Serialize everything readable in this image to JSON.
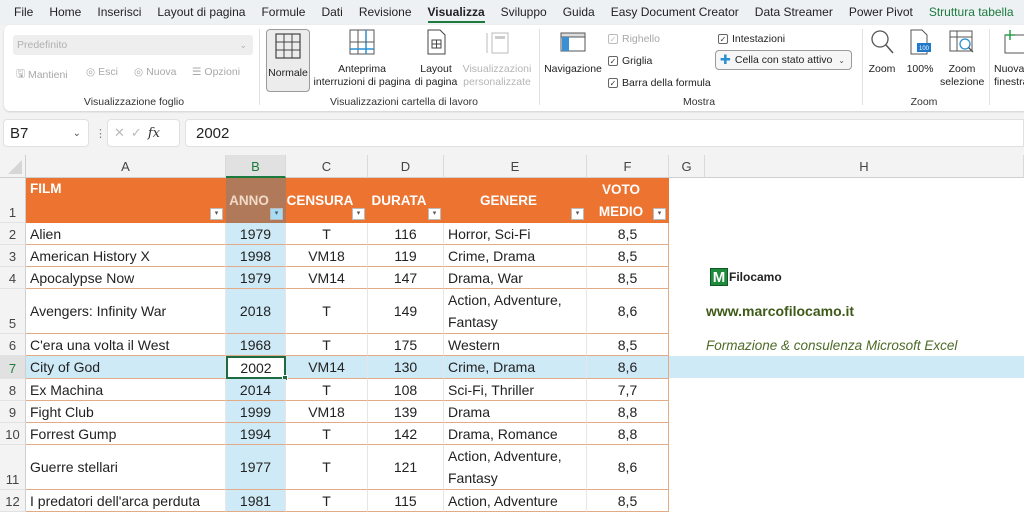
{
  "tabs": [
    {
      "label": "File"
    },
    {
      "label": "Home"
    },
    {
      "label": "Inserisci"
    },
    {
      "label": "Layout di pagina"
    },
    {
      "label": "Formule"
    },
    {
      "label": "Dati"
    },
    {
      "label": "Revisione"
    },
    {
      "label": "Visualizza",
      "active": true
    },
    {
      "label": "Sviluppo"
    },
    {
      "label": "Guida"
    },
    {
      "label": "Easy Document Creator"
    },
    {
      "label": "Data Streamer"
    },
    {
      "label": "Power Pivot"
    },
    {
      "label": "Struttura tabella",
      "contextual": true
    }
  ],
  "ribbon": {
    "sheet_view": {
      "select_value": "Predefinito",
      "keep": "Mantieni",
      "exit": "Esci",
      "new": "Nuova",
      "options": "Opzioni",
      "group_label": "Visualizzazione foglio"
    },
    "workbook_views": {
      "normal": "Normale",
      "page_break_1": "Anteprima",
      "page_break_2": "interruzioni di pagina",
      "page_layout_1": "Layout",
      "page_layout_2": "di pagina",
      "custom_1": "Visualizzazioni",
      "custom_2": "personalizzate",
      "group_label": "Visualizzazioni cartella di lavoro"
    },
    "show": {
      "navigation": "Navigazione",
      "ruler": "Righello",
      "gridlines": "Griglia",
      "formula_bar": "Barra della formula",
      "headings": "Intestazioni",
      "focus_cell": "Cella con stato attivo",
      "group_label": "Mostra"
    },
    "zoom": {
      "zoom": "Zoom",
      "hundred": "100%",
      "hundred_icon_text": "100",
      "zoom_sel_1": "Zoom",
      "zoom_sel_2": "selezione",
      "group_label": "Zoom"
    },
    "window": {
      "new_window_1": "Nuova",
      "new_window_2": "finestra"
    }
  },
  "formula_bar": {
    "name_box": "B7",
    "value": "2002",
    "fx": "fx"
  },
  "columns": [
    "A",
    "B",
    "C",
    "D",
    "E",
    "F",
    "G",
    "H"
  ],
  "selected_column": "B",
  "table": {
    "headers": [
      "FILM",
      "ANNO",
      "CENSURA",
      "DURATA",
      "GENERE",
      "VOTO MEDIO"
    ],
    "header_lines": [
      [
        "FILM"
      ],
      [
        "ANNO"
      ],
      [
        "CENSURA"
      ],
      [
        "DURATA"
      ],
      [
        "GENERE"
      ],
      [
        "VOTO",
        "MEDIO"
      ]
    ],
    "rows": [
      {
        "row": "2",
        "film": "Alien",
        "anno": "1979",
        "censura": "T",
        "durata": "116",
        "genere": "Horror, Sci-Fi",
        "voto": "8,5"
      },
      {
        "row": "3",
        "film": "American History X",
        "anno": "1998",
        "censura": "VM18",
        "durata": "119",
        "genere": "Crime, Drama",
        "voto": "8,5"
      },
      {
        "row": "4",
        "film": "Apocalypse Now",
        "anno": "1979",
        "censura": "VM14",
        "durata": "147",
        "genere": "Drama, War",
        "voto": "8,5"
      },
      {
        "row": "5",
        "film": "Avengers: Infinity War",
        "anno": "2018",
        "censura": "T",
        "durata": "149",
        "genere": "Action, Adventure, Fantasy",
        "voto": "8,6"
      },
      {
        "row": "6",
        "film": "C'era una volta il West",
        "anno": "1968",
        "censura": "T",
        "durata": "175",
        "genere": "Western",
        "voto": "8,5"
      },
      {
        "row": "7",
        "film": "City of God",
        "anno": "2002",
        "censura": "VM14",
        "durata": "130",
        "genere": "Crime, Drama",
        "voto": "8,6"
      },
      {
        "row": "8",
        "film": "Ex Machina",
        "anno": "2014",
        "censura": "T",
        "durata": "108",
        "genere": "Sci-Fi, Thriller",
        "voto": "7,7"
      },
      {
        "row": "9",
        "film": "Fight Club",
        "anno": "1999",
        "censura": "VM18",
        "durata": "139",
        "genere": "Drama",
        "voto": "8,8"
      },
      {
        "row": "10",
        "film": "Forrest Gump",
        "anno": "1994",
        "censura": "T",
        "durata": "142",
        "genere": "Drama, Romance",
        "voto": "8,8"
      },
      {
        "row": "11",
        "film": "Guerre stellari",
        "anno": "1977",
        "censura": "T",
        "durata": "121",
        "genere": "Action, Adventure, Fantasy",
        "voto": "8,6"
      },
      {
        "row": "12",
        "film": "I predatori dell'arca perduta",
        "anno": "1981",
        "censura": "T",
        "durata": "115",
        "genere": "Action, Adventure",
        "voto": "8,5"
      }
    ]
  },
  "branding": {
    "logo_letter": "M",
    "logo_name": "Filocamo",
    "website": "www.marcofilocamo.it",
    "tagline": "Formazione & consulenza Microsoft Excel"
  },
  "colors": {
    "accent": "#1b7a3e",
    "table_header": "#ed7331",
    "selection_band": "#cfeaf7"
  }
}
